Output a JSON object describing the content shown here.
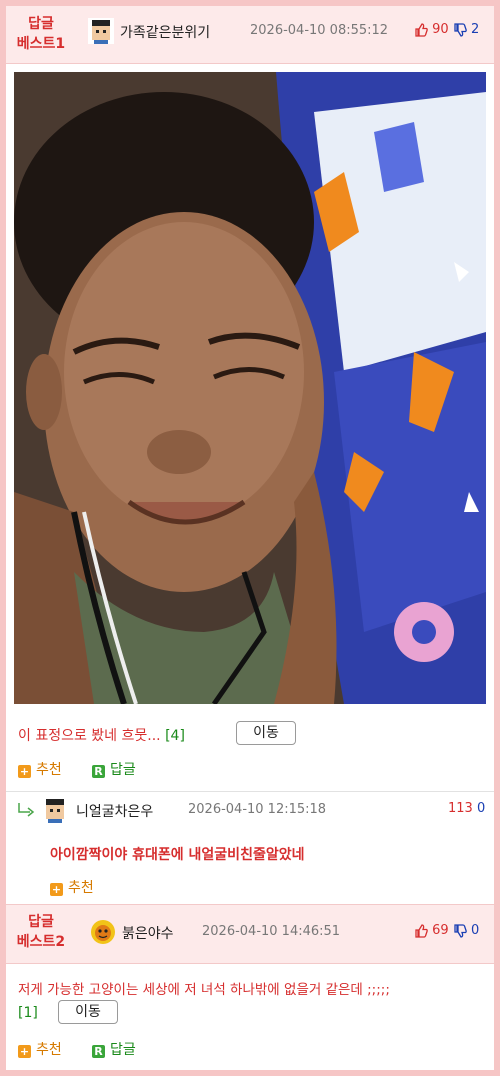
{
  "best1": {
    "tag_line1": "답글",
    "tag_line2": "베스트1",
    "nickname": "가족같은분위기",
    "date": "2026-04-10 08:55:12",
    "up": "90",
    "down": "2",
    "comment": "이 표정으로 봤네 흐뭇...",
    "reply_count": "[4]",
    "move_label": "이동",
    "recommend_label": "추천",
    "reply_label": "답글"
  },
  "reply": {
    "nickname": "니얼굴차은우",
    "date": "2026-04-10 12:15:18",
    "up": "113",
    "down": "0",
    "comment": "아이깜짝이야 휴대폰에 내얼굴비친줄알았네",
    "recommend_label": "추천"
  },
  "best2": {
    "tag_line1": "답글",
    "tag_line2": "베스트2",
    "nickname": "붉은야수",
    "date": "2026-04-10 14:46:51",
    "up": "69",
    "down": "0",
    "comment": "저게 가능한 고양이는 세상에 저 녀석 하나밖에 없을거 같은데 ;;;;;",
    "reply_count": "[1]",
    "move_label": "이동",
    "recommend_label": "추천",
    "reply_label": "답글"
  },
  "icons": {
    "thumb_up": "thumbs-up-icon",
    "thumb_down": "thumbs-down-icon",
    "plus": "plus-icon",
    "reply": "reply-icon",
    "reply_arrow": "reply-arrow-icon"
  },
  "colors": {
    "accent_red": "#d62e2e",
    "down_blue": "#1a3fb3",
    "green": "#1a8a1a",
    "frame_pink": "#f6c6c6"
  }
}
